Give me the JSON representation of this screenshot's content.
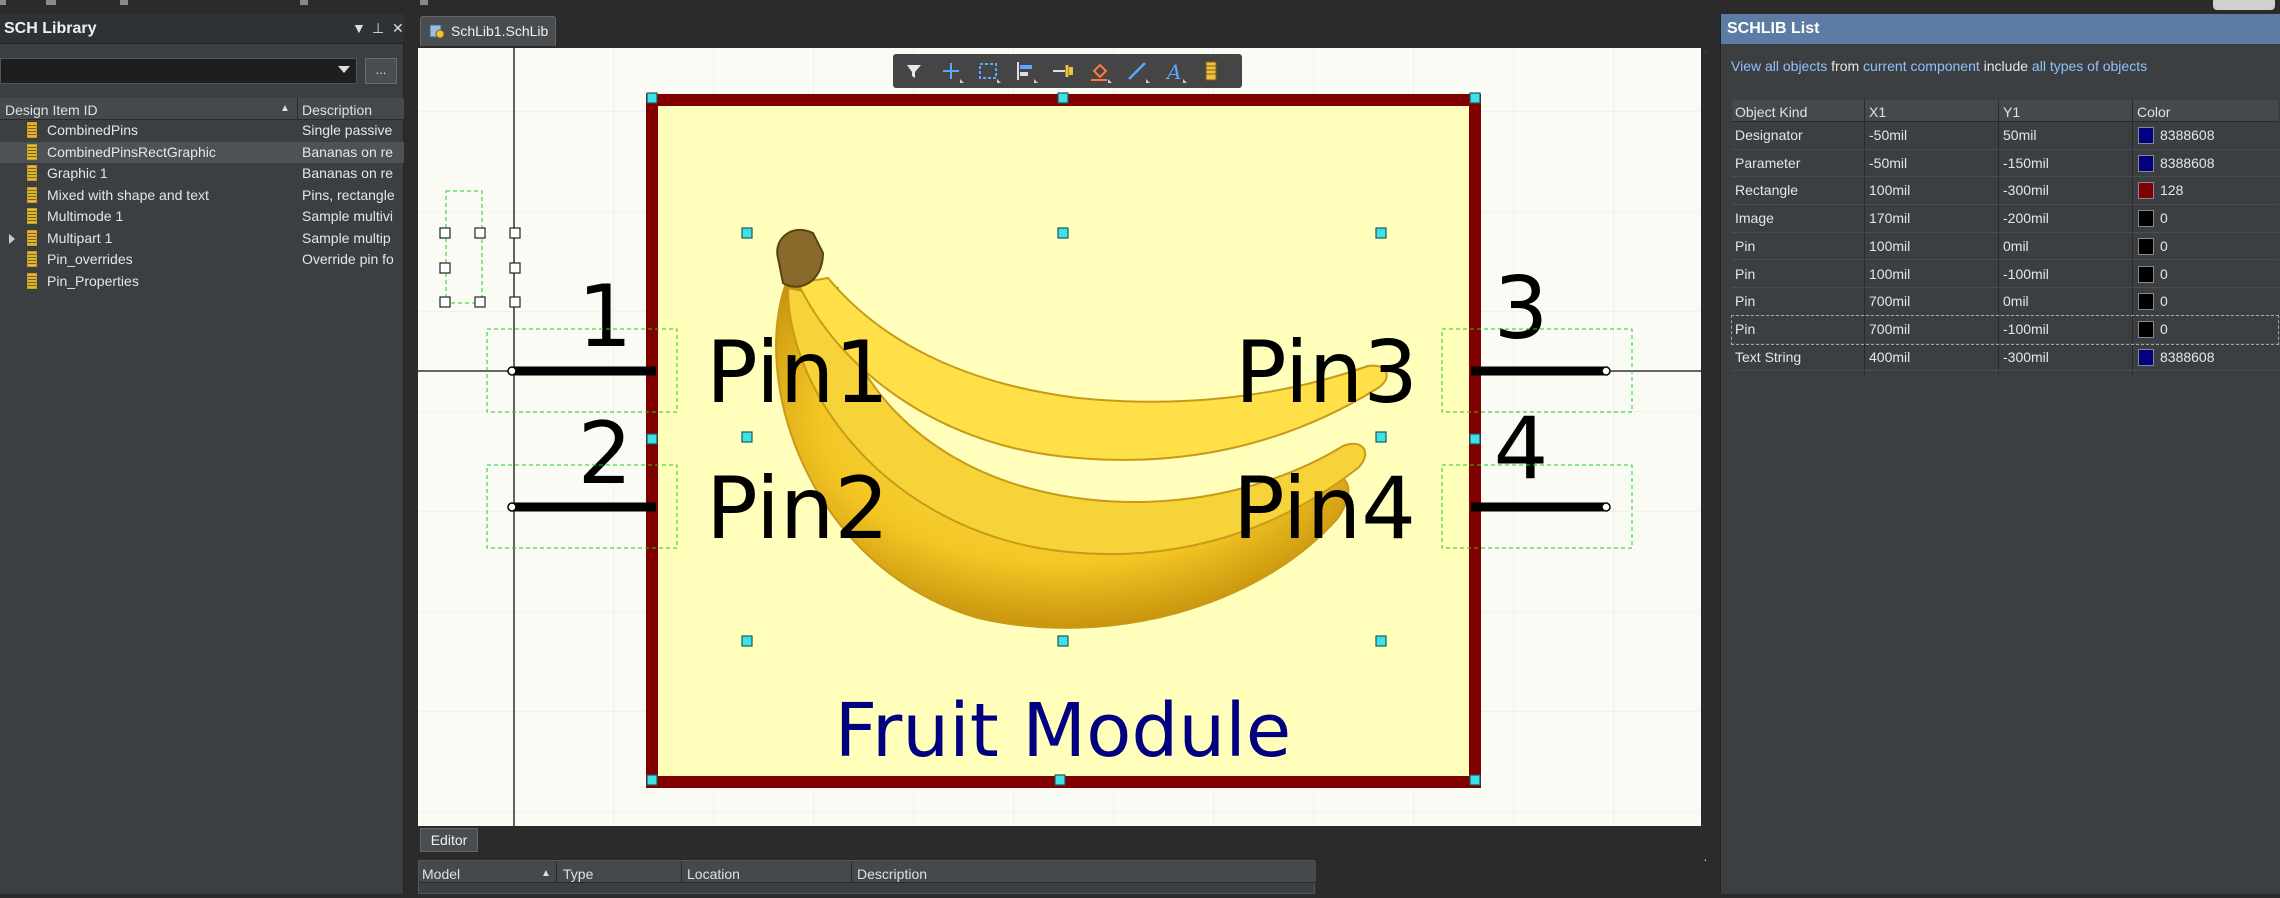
{
  "sch_library": {
    "title": "SCH Library",
    "browse_label": "...",
    "columns": [
      "Design Item ID",
      "Description"
    ],
    "items": [
      {
        "name": "CombinedPins",
        "description": "Single passive"
      },
      {
        "name": "CombinedPinsRectGraphic",
        "description": "Bananas on re"
      },
      {
        "name": "Graphic 1",
        "description": "Bananas on re"
      },
      {
        "name": "Mixed with shape and text",
        "description": "Pins, rectangle"
      },
      {
        "name": "Multimode 1",
        "description": "Sample multivi"
      },
      {
        "name": "Multipart 1",
        "description": "Sample multip"
      },
      {
        "name": "Pin_overrides",
        "description": "Override pin fo"
      },
      {
        "name": "Pin_Properties",
        "description": ""
      }
    ],
    "selected_index": 1
  },
  "document": {
    "tab_label": "SchLib1.SchLib"
  },
  "component": {
    "pins": [
      {
        "number": "1",
        "name": "Pin1"
      },
      {
        "number": "2",
        "name": "Pin2"
      },
      {
        "number": "3",
        "name": "Pin3"
      },
      {
        "number": "4",
        "name": "Pin4"
      }
    ],
    "text_string": "Fruit Module",
    "body_fill": "#ffffbb",
    "body_border": "#800000",
    "text_color": "#000080"
  },
  "editor_panel": {
    "tab_label": "Editor",
    "columns": [
      "Model",
      "Type",
      "Location",
      "Description"
    ]
  },
  "toolbar": {
    "icons": [
      "filter-icon",
      "crosshair-icon",
      "select-rect-icon",
      "align-icon",
      "pin-icon",
      "fill-icon",
      "line-icon",
      "text-icon",
      "component-icon"
    ]
  },
  "schlib_list": {
    "title": "SCHLIB List",
    "filter": {
      "view_link": "View all objects",
      "from_text": "from",
      "component_link": "current component",
      "include_text": "include",
      "types_link": "all types of objects"
    },
    "columns": [
      "Object Kind",
      "X1",
      "Y1",
      "Color"
    ],
    "rows": [
      {
        "kind": "Designator",
        "x1": "-50mil",
        "y1": "50mil",
        "swatch": "#000080",
        "color": "8388608"
      },
      {
        "kind": "Parameter",
        "x1": "-50mil",
        "y1": "-150mil",
        "swatch": "#000080",
        "color": "8388608"
      },
      {
        "kind": "Rectangle",
        "x1": "100mil",
        "y1": "-300mil",
        "swatch": "#800000",
        "color": "128"
      },
      {
        "kind": "Image",
        "x1": "170mil",
        "y1": "-200mil",
        "swatch": "#000000",
        "color": "0"
      },
      {
        "kind": "Pin",
        "x1": "100mil",
        "y1": "0mil",
        "swatch": "#000000",
        "color": "0"
      },
      {
        "kind": "Pin",
        "x1": "100mil",
        "y1": "-100mil",
        "swatch": "#000000",
        "color": "0"
      },
      {
        "kind": "Pin",
        "x1": "700mil",
        "y1": "0mil",
        "swatch": "#000000",
        "color": "0"
      },
      {
        "kind": "Pin",
        "x1": "700mil",
        "y1": "-100mil",
        "swatch": "#000000",
        "color": "0"
      },
      {
        "kind": "Text String",
        "x1": "400mil",
        "y1": "-300mil",
        "swatch": "#000080",
        "color": "8388608"
      }
    ]
  }
}
